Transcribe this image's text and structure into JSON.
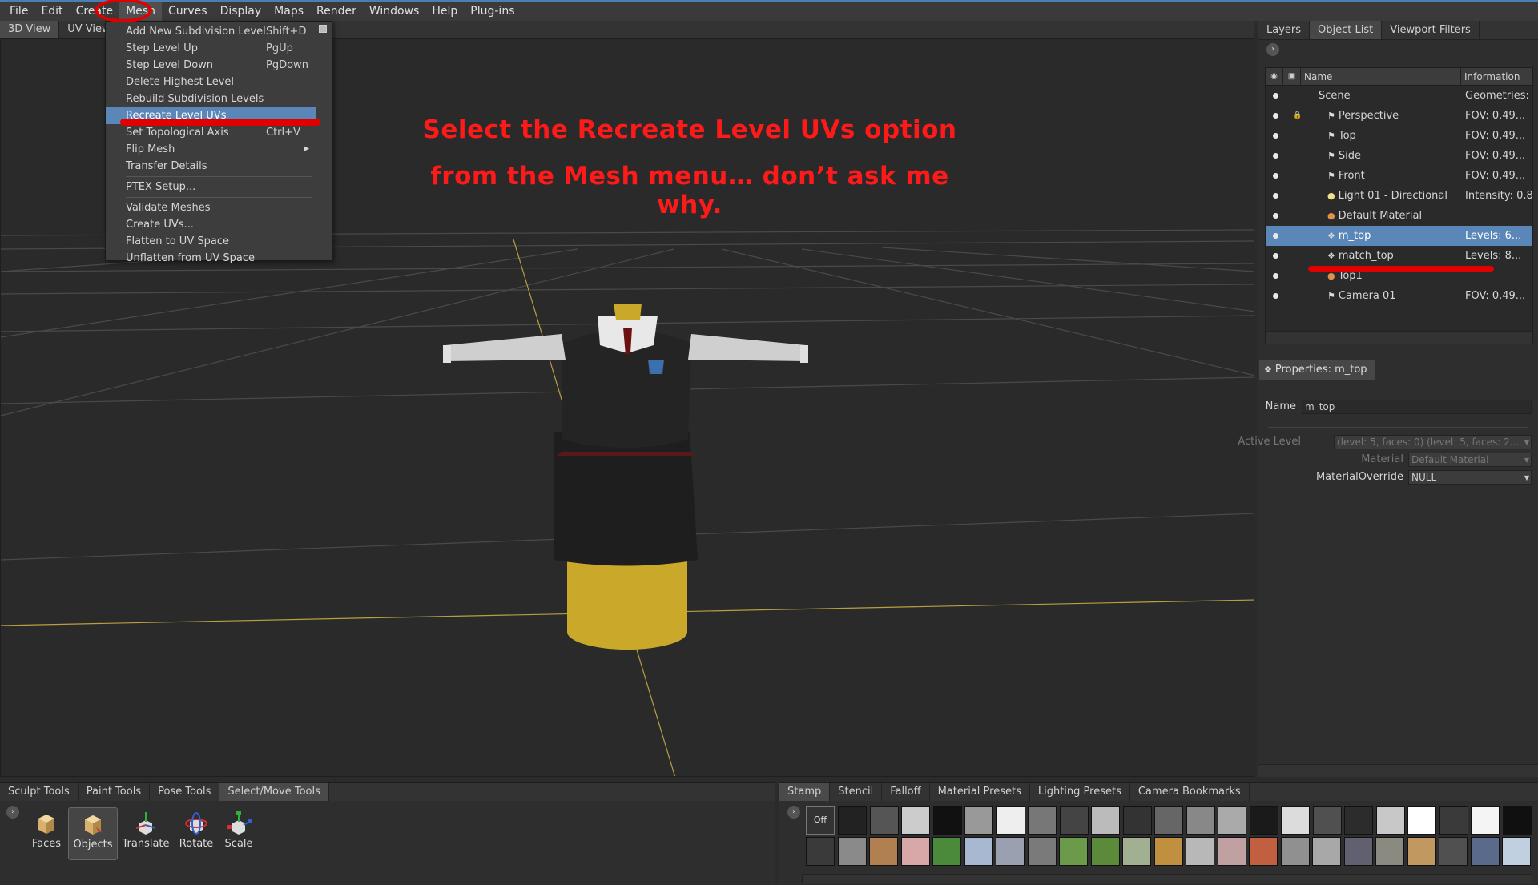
{
  "menubar": {
    "items": [
      "File",
      "Edit",
      "Create",
      "Mesh",
      "Curves",
      "Display",
      "Maps",
      "Render",
      "Windows",
      "Help",
      "Plug-ins"
    ],
    "active": "Mesh"
  },
  "view_tabs": [
    "3D View",
    "UV View"
  ],
  "mesh_menu": {
    "items": [
      {
        "label": "Add New Subdivision Level",
        "shortcut": "Shift+D"
      },
      {
        "label": "Step Level Up",
        "shortcut": "PgUp"
      },
      {
        "label": "Step Level Down",
        "shortcut": "PgDown"
      },
      {
        "label": "Delete Highest Level",
        "shortcut": ""
      },
      {
        "label": "Rebuild Subdivision Levels",
        "shortcut": ""
      },
      {
        "label": "Recreate Level UVs",
        "shortcut": ""
      },
      {
        "label": "Set Topological Axis",
        "shortcut": "Ctrl+V"
      },
      {
        "label": "Flip Mesh",
        "shortcut": ""
      },
      {
        "label": "Transfer Details",
        "shortcut": ""
      },
      {
        "label": "PTEX Setup...",
        "shortcut": ""
      },
      {
        "label": "Validate Meshes",
        "shortcut": ""
      },
      {
        "label": "Create UVs...",
        "shortcut": ""
      },
      {
        "label": "Flatten to UV Space",
        "shortcut": ""
      },
      {
        "label": "Unflatten from UV Space",
        "shortcut": ""
      }
    ],
    "highlighted": "Recreate Level UVs"
  },
  "annotation": {
    "line1": "Select the Recreate Level UVs option",
    "line2": "from the Mesh menu… don’t ask me why.",
    "color": "#ff1a1a"
  },
  "right_tabs": [
    "Layers",
    "Object List",
    "Viewport Filters"
  ],
  "outliner": {
    "col_name": "Name",
    "col_info": "Information",
    "rows": [
      {
        "name": "Scene",
        "info": "Geometries: ..",
        "icon": "",
        "depth": 0
      },
      {
        "name": "Perspective",
        "info": "FOV: 0.49...",
        "icon": "camera",
        "depth": 1,
        "locked": true
      },
      {
        "name": "Top",
        "info": "FOV: 0.49...",
        "icon": "camera",
        "depth": 1
      },
      {
        "name": "Side",
        "info": "FOV: 0.49...",
        "icon": "camera",
        "depth": 1
      },
      {
        "name": "Front",
        "info": "FOV: 0.49...",
        "icon": "camera",
        "depth": 1
      },
      {
        "name": "Light 01 - Directional",
        "info": "Intensity: 0.80",
        "icon": "light",
        "depth": 1
      },
      {
        "name": "Default Material",
        "info": "",
        "icon": "material",
        "depth": 1
      },
      {
        "name": "m_top",
        "info": "Levels: 6...",
        "icon": "mesh",
        "depth": 1,
        "selected": true
      },
      {
        "name": "match_top",
        "info": "Levels: 8...",
        "icon": "mesh",
        "depth": 1
      },
      {
        "name": "Top1",
        "info": "",
        "icon": "material",
        "depth": 1
      },
      {
        "name": "Camera 01",
        "info": "FOV: 0.49...",
        "icon": "camera",
        "depth": 1
      }
    ]
  },
  "properties": {
    "tab": "Properties: m_top",
    "name_label": "Name",
    "name_value": "m_top",
    "active_level_label": "Active Level",
    "active_level_value": "(level: 5, faces: 0) (level: 5, faces: 2...",
    "material_label": "Material",
    "material_value": "Default Material",
    "override_label": "MaterialOverride",
    "override_value": "NULL"
  },
  "bottom_tabs": [
    "Sculpt Tools",
    "Paint Tools",
    "Pose Tools",
    "Select/Move Tools"
  ],
  "bottom_active": "Select/Move Tools",
  "tools": [
    "Faces",
    "Objects",
    "Translate",
    "Rotate",
    "Scale"
  ],
  "tools_active": "Objects",
  "stamp_tabs": [
    "Stamp",
    "Stencil",
    "Falloff",
    "Material Presets",
    "Lighting Presets",
    "Camera Bookmarks"
  ],
  "stamp_active": "Stamp",
  "stamp_off_label": "Off",
  "colors": {
    "accent": "#5b87b8",
    "annotation_red": "#e00000",
    "menubar": "#3a3a3a",
    "viewport": "#2a2a2a"
  }
}
